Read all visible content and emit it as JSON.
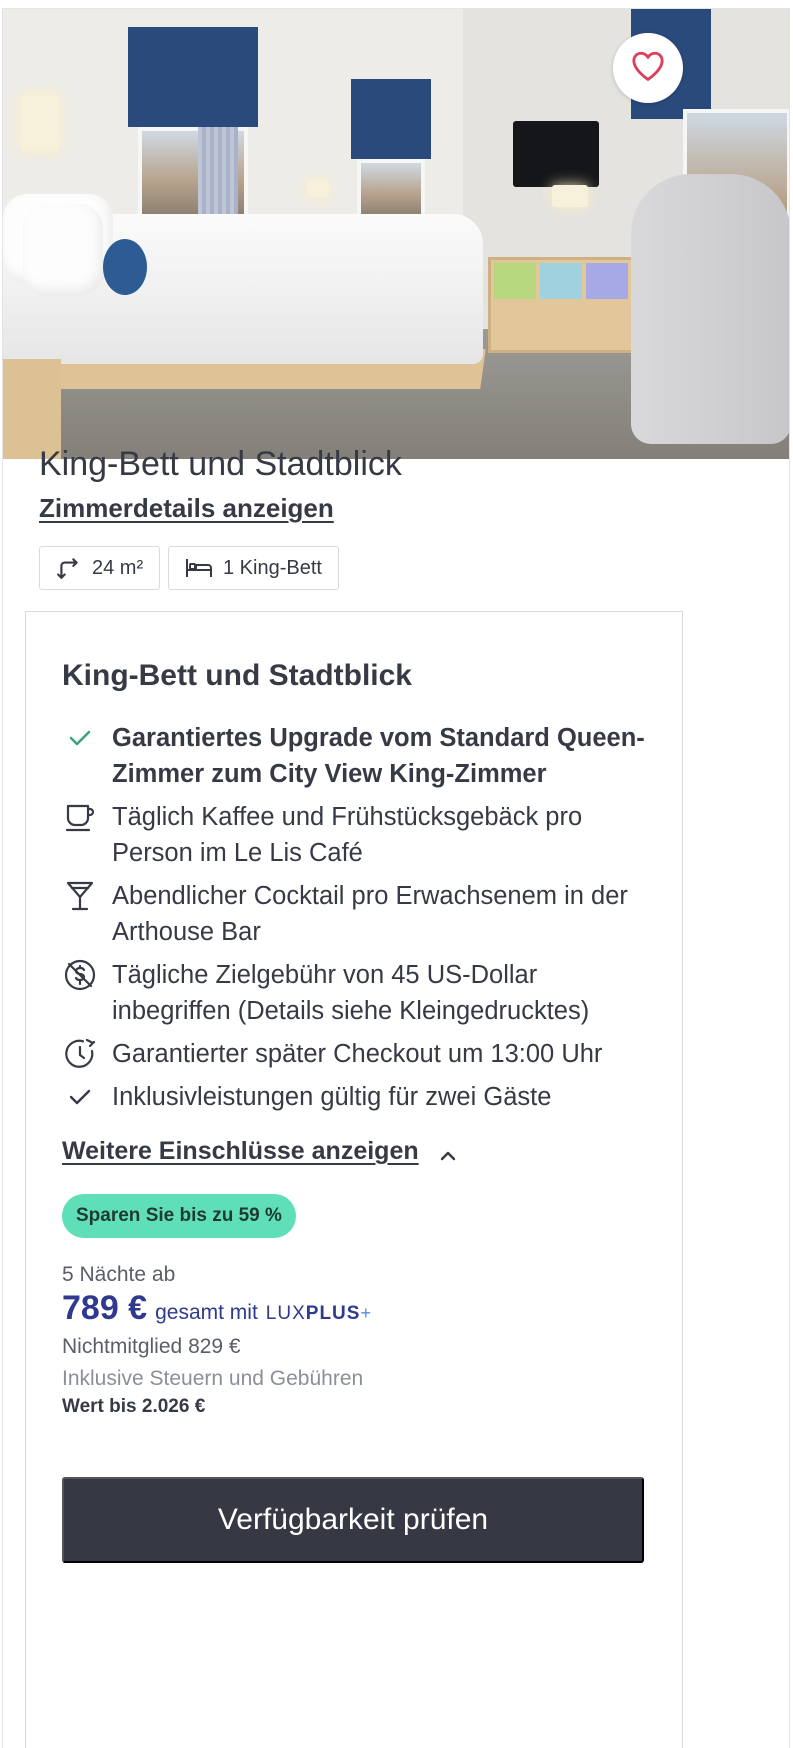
{
  "hero": {
    "image_alt": "Hotelzimmer mit King-Bett und Stadtblick",
    "favorite_icon": "heart-icon"
  },
  "room": {
    "title": "King-Bett und Stadtblick",
    "details_link": "Zimmerdetails anzeigen",
    "chips": [
      {
        "icon": "room-size-icon",
        "label": "24 m²"
      },
      {
        "icon": "bed-icon",
        "label": "1 King-Bett"
      }
    ]
  },
  "package": {
    "title": "King-Bett und Stadtblick",
    "inclusions": [
      {
        "icon": "check-icon",
        "text": "Garantiertes Upgrade vom Standard Queen-Zimmer zum City View King-Zimmer",
        "bold": true,
        "icon_color": "#3aa57c"
      },
      {
        "icon": "coffee-cup-icon",
        "text": "Täglich Kaffee und Frühstücksgebäck pro Person im Le Lis Café"
      },
      {
        "icon": "cocktail-glass-icon",
        "text": "Abendlicher Cocktail pro Erwachsenem in der Arthouse Bar"
      },
      {
        "icon": "no-fee-icon",
        "text": "Tägliche Zielgebühr von 45 US-Dollar inbegriffen (Details siehe Kleingedrucktes)"
      },
      {
        "icon": "late-checkout-clock-icon",
        "text": "Garantierter später Checkout um 13:00 Uhr"
      },
      {
        "icon": "check-icon",
        "text": "Inklusivleistungen gültig für zwei Gäste"
      }
    ],
    "more_link": "Weitere Einschlüsse anzeigen",
    "savings_badge": "Sparen Sie bis zu 59 %",
    "nights_label": "5 Nächte ab",
    "price": "789 €",
    "price_suffix": "gesamt mit",
    "lux_brand_light": "LUX",
    "lux_brand_bold": "PLUS",
    "lux_brand_plus": "+",
    "nonmember_label": "Nichtmitglied",
    "nonmember_price": "829 €",
    "taxes_note": "Inklusive Steuern und Gebühren",
    "worth_label": "Wert bis 2.026 €",
    "cta_label": "Verfügbarkeit prüfen"
  },
  "colors": {
    "primary_text": "#363a45",
    "price_blue": "#2f3a8f",
    "badge_green": "#5fdfb8",
    "cta_bg": "#363843",
    "heart_red": "#d9405a"
  }
}
